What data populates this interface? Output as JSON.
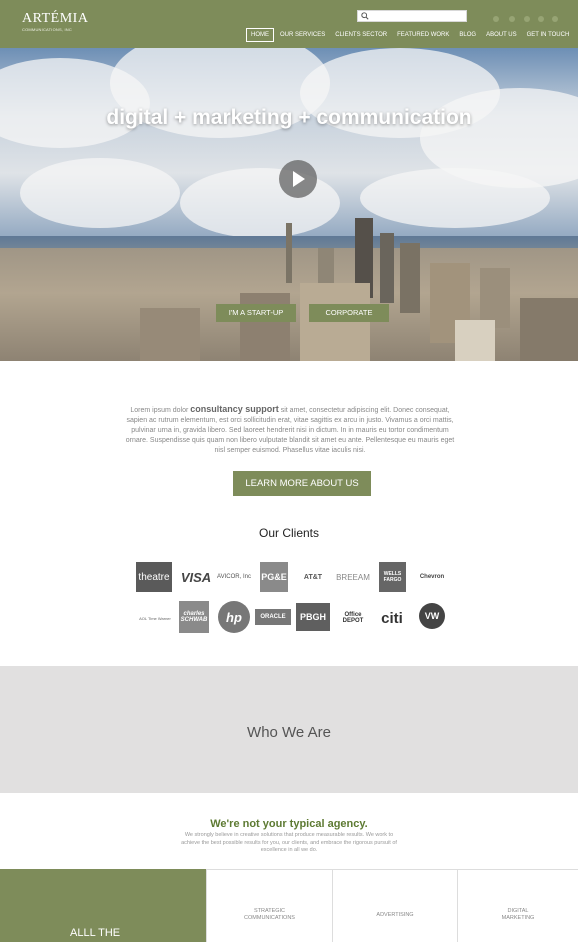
{
  "header": {
    "logo_main": "ARTÉMIA",
    "logo_sub": "COMMUNICATIONS, INC",
    "search_placeholder": "",
    "nav": [
      "HOME",
      "OUR SERVICES",
      "CLIENTS SECTOR",
      "FEATURED WORK",
      "BLOG",
      "ABOUT US",
      "GET IN TOUCH"
    ],
    "active_nav": "HOME",
    "social_icons": [
      "twitter-icon",
      "facebook-icon",
      "facebook-f-icon",
      "linkedin-icon",
      "youtube-icon"
    ]
  },
  "hero": {
    "title": "digital + marketing + communication",
    "buttons": [
      "I'M A START-UP",
      "CORPORATE"
    ]
  },
  "intro": {
    "before": "Lorem ipsum dolor ",
    "emphasis": "consultancy support",
    "after": " sit amet, consectetur adipiscing elit. Donec consequat, sapien ac rutrum elementum, est orci sollicitudin erat, vitae sagittis ex arcu in justo. Vivamus a orci mattis, pulvinar urna in, gravida libero. Sed laoreet hendrerit nisi in dictum. In in mauris eu tortor condimentum ornare. Suspendisse quis quam non libero vulputate blandit sit amet eu ante. Pellentesque eu mauris eget nisl semper euismod. Phasellus vitae iaculis nisi."
  },
  "learn_button": "LEARN MORE ABOUT US",
  "clients": {
    "title": "Our Clients",
    "row1": [
      "theatre",
      "VISA",
      "AVICOR, Inc",
      "PG&E",
      "AT&T",
      "BREEAM",
      "WELLS FARGO",
      "Chevron"
    ],
    "row2": [
      "AOL Time Warner",
      "charles SCHWAB",
      "hp",
      "ORACLE",
      "PBGH",
      "Office DEPOT",
      "citi",
      "VW"
    ]
  },
  "who": {
    "title": "Who We Are"
  },
  "agency": {
    "title": "We're not your typical agency.",
    "text": "We strongly believe in creative solutions that produce measurable results. We work to achieve the best possible results for you, our clients, and embrace the rigorous pursuit of excellence in all we do."
  },
  "bottom": {
    "green_text": "ALLL THE",
    "panels": [
      "STRATEGIC COMMUNICATIONS",
      "ADVERTISING",
      "DIGITAL MARKETING"
    ]
  },
  "colors": {
    "brand_green": "#7e8c5a",
    "agency_green": "#5d7a32"
  }
}
